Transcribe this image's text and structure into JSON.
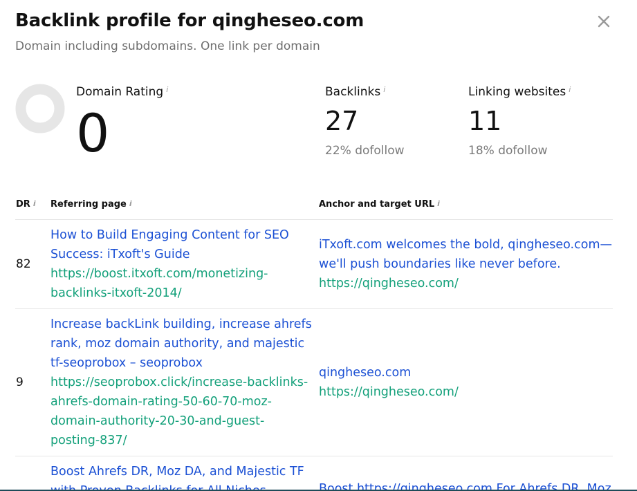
{
  "title": "Backlink profile for qingheseo.com",
  "subtitle": "Domain including subdomains. One link per domain",
  "info_glyph": "i",
  "metrics": {
    "domain_rating": {
      "label": "Domain Rating",
      "value": "0",
      "ring_fill": 0
    },
    "backlinks": {
      "label": "Backlinks",
      "value": "27",
      "dofollow": "22% dofollow"
    },
    "linking_websites": {
      "label": "Linking websites",
      "value": "11",
      "dofollow": "18% dofollow"
    }
  },
  "table": {
    "headers": {
      "dr": "DR",
      "referring": "Referring page",
      "anchor": "Anchor and target URL"
    },
    "rows": [
      {
        "dr": "82",
        "title_lines": [
          "How to Build Engaging Content for SEO",
          "Success: iTxoft's Guide"
        ],
        "url_lines": [
          "https://boost.itxoft.com/monetizing-",
          "backlinks-itxoft-2014/"
        ],
        "anchor_lines": [
          "iTxoft.com welcomes the bold, qingheseo.com—",
          "we'll push boundaries like never before."
        ],
        "target_lines": [
          "https://qingheseo.com/"
        ]
      },
      {
        "dr": "9",
        "title_lines": [
          "Increase backLink building, increase ahrefs",
          "rank, moz domain authority, and majestic",
          "tf-seoprobox – seoprobox"
        ],
        "url_lines": [
          "https://seoprobox.click/increase-backlinks-",
          "ahrefs-domain-rating-50-60-70-moz-",
          "domain-authority-20-30-and-guest-",
          "posting-837/"
        ],
        "anchor_lines": [
          "qingheseo.com"
        ],
        "target_lines": [
          "https://qingheseo.com/"
        ]
      },
      {
        "dr": "",
        "title_lines": [
          "Boost Ahrefs DR, Moz DA, and Majestic TF",
          "with Proven Backlinks for All Niches"
        ],
        "url_lines": [],
        "anchor_lines": [
          "Boost https://qingheseo.com For Ahrefs DR, Moz"
        ],
        "target_lines": []
      }
    ]
  },
  "colors": {
    "link_blue": "#1b50d4",
    "url_green": "#13a07a",
    "ring_gray": "#e6e6e6",
    "bottom_rule": "#1e4b59"
  },
  "icons": {
    "close": "close-icon"
  }
}
